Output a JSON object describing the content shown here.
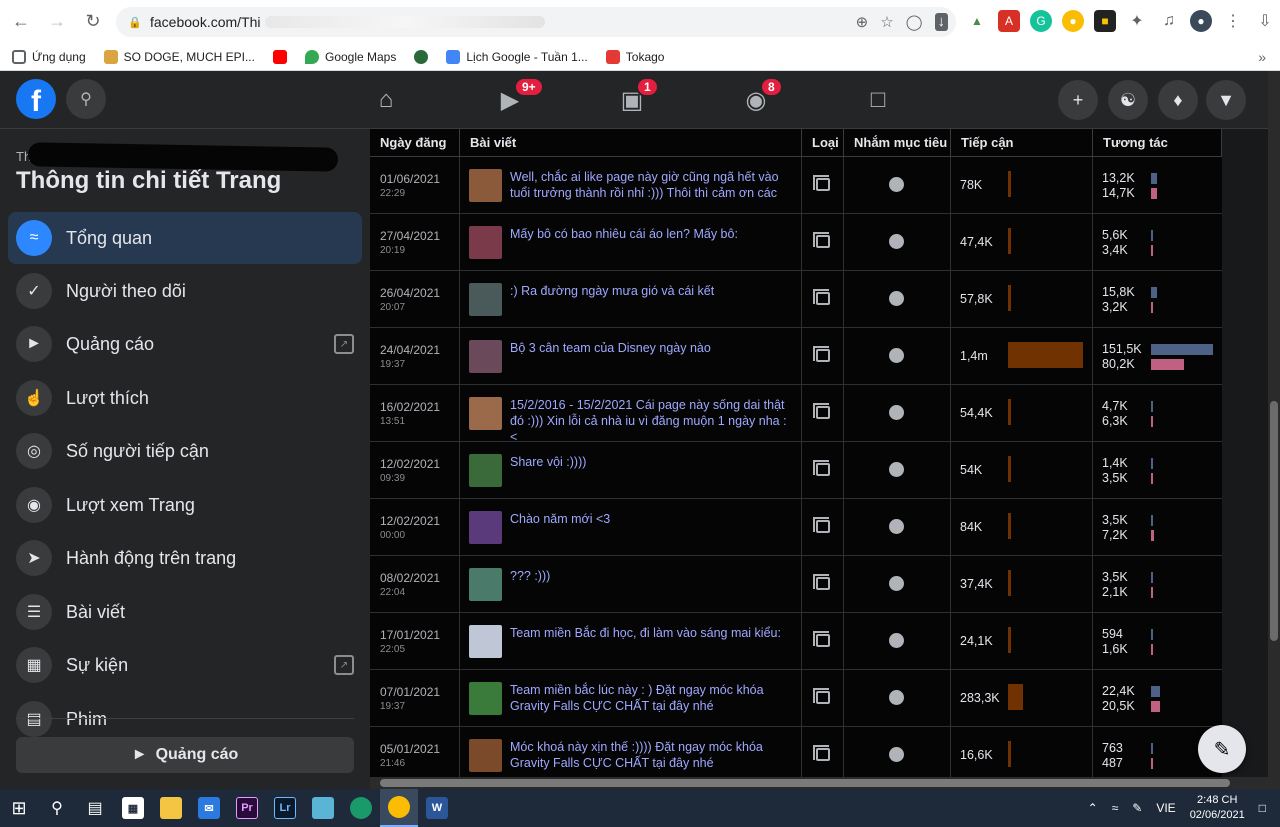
{
  "browser": {
    "url": "facebook.com/Thi",
    "bookmarks": [
      "Ứng dụng",
      "SO DOGE, MUCH EPI...",
      "Google Maps",
      "Lịch Google - Tuần 1...",
      "Tokago"
    ]
  },
  "fb_nav": {
    "badges": {
      "watch": "9+",
      "marketplace": "1",
      "groups": "8"
    }
  },
  "sidebar": {
    "page_name": "Thị",
    "title": "Thông tin chi tiết Trang",
    "items": [
      {
        "label": "Tổng quan",
        "icon": "trend-icon",
        "active": true
      },
      {
        "label": "Người theo dõi",
        "icon": "check-box-icon"
      },
      {
        "label": "Quảng cáo",
        "icon": "megaphone-icon",
        "external": true
      },
      {
        "label": "Lượt thích",
        "icon": "thumbs-up-icon"
      },
      {
        "label": "Số người tiếp cận",
        "icon": "broadcast-icon"
      },
      {
        "label": "Lượt xem Trang",
        "icon": "eye-icon"
      },
      {
        "label": "Hành động trên trang",
        "icon": "cursor-icon"
      },
      {
        "label": "Bài viết",
        "icon": "post-icon"
      },
      {
        "label": "Sự kiện",
        "icon": "calendar-icon",
        "external": true
      },
      {
        "label": "Phim",
        "icon": "film-icon"
      }
    ],
    "ad_button": "Quảng cáo"
  },
  "table": {
    "headers": [
      "Ngày đăng",
      "Bài viết",
      "Loại",
      "Nhắm mục tiêu",
      "Tiếp cận",
      "Tương tác"
    ],
    "rows": [
      {
        "date": "01/06/2021",
        "time": "22:29",
        "post": "Well, chắc ai like page này giờ cũng ngã hết vào tuổi trưởng thành rồi nhỉ :))) Thôi thì cảm ơn các",
        "reach": "78K",
        "reach_pct": 0.03,
        "e1": "13,2K",
        "e2": "14,7K",
        "e1_pct": 0.09,
        "e2_pct": 0.1,
        "thumb": "#8a5a3a"
      },
      {
        "date": "27/04/2021",
        "time": "20:19",
        "post": "Mấy bô có bao nhiêu cái áo len? Mấy bô:",
        "reach": "47,4K",
        "reach_pct": 0.02,
        "e1": "5,6K",
        "e2": "3,4K",
        "e1_pct": 0.04,
        "e2_pct": 0.03,
        "thumb": "#7a3a4a"
      },
      {
        "date": "26/04/2021",
        "time": "20:07",
        "post": ":) Ra đường ngày mưa gió và cái kết",
        "reach": "57,8K",
        "reach_pct": 0.03,
        "e1": "15,8K",
        "e2": "3,2K",
        "e1_pct": 0.1,
        "e2_pct": 0.03,
        "thumb": "#4a5a5a"
      },
      {
        "date": "24/04/2021",
        "time": "19:37",
        "post": "Bộ 3 cân team của Disney ngày nào",
        "reach": "1,4m",
        "reach_pct": 1.0,
        "e1": "151,5K",
        "e2": "80,2K",
        "e1_pct": 1.0,
        "e2_pct": 0.53,
        "thumb": "#6a4a5a"
      },
      {
        "date": "16/02/2021",
        "time": "13:51",
        "post": "15/2/2016 - 15/2/2021 Cái page này sống dai thật đó :))) Xin lỗi cả nhà iu vì đăng muộn 1 ngày nha :<",
        "reach": "54,4K",
        "reach_pct": 0.03,
        "e1": "4,7K",
        "e2": "6,3K",
        "e1_pct": 0.03,
        "e2_pct": 0.04,
        "thumb": "#9a6a4a"
      },
      {
        "date": "12/02/2021",
        "time": "09:39",
        "post": "Share vội :))))",
        "reach": "54K",
        "reach_pct": 0.03,
        "e1": "1,4K",
        "e2": "3,5K",
        "e1_pct": 0.02,
        "e2_pct": 0.03,
        "thumb": "#3a6a3a"
      },
      {
        "date": "12/02/2021",
        "time": "00:00",
        "post": "Chào năm mới <3",
        "reach": "84K",
        "reach_pct": 0.04,
        "e1": "3,5K",
        "e2": "7,2K",
        "e1_pct": 0.03,
        "e2_pct": 0.05,
        "thumb": "#5a3a7a"
      },
      {
        "date": "08/02/2021",
        "time": "22:04",
        "post": "??? :)))",
        "reach": "37,4K",
        "reach_pct": 0.02,
        "e1": "3,5K",
        "e2": "2,1K",
        "e1_pct": 0.03,
        "e2_pct": 0.02,
        "thumb": "#4a7a6a"
      },
      {
        "date": "17/01/2021",
        "time": "22:05",
        "post": "Team miền Bắc đi học, đi làm vào sáng mai kiểu:",
        "reach": "24,1K",
        "reach_pct": 0.02,
        "e1": "594",
        "e2": "1,6K",
        "e1_pct": 0.01,
        "e2_pct": 0.02,
        "thumb": "#bfc6d6"
      },
      {
        "date": "07/01/2021",
        "time": "19:37",
        "post": "Team miền bắc lúc này : ) Đặt ngay móc khóa Gravity Falls CỰC CHẤT tại đây nhé",
        "reach": "283,3K",
        "reach_pct": 0.2,
        "e1": "22,4K",
        "e2": "20,5K",
        "e1_pct": 0.15,
        "e2_pct": 0.14,
        "thumb": "#3a7a3a"
      },
      {
        "date": "05/01/2021",
        "time": "21:46",
        "post": "Móc khoá này xịn thế :)))) Đặt ngay móc khóa Gravity Falls CỰC CHẤT tại đây nhé",
        "reach": "16,6K",
        "reach_pct": 0.01,
        "e1": "763",
        "e2": "487",
        "e1_pct": 0.01,
        "e2_pct": 0.01,
        "thumb": "#7a4a2a"
      }
    ]
  },
  "taskbar": {
    "lang": "VIE",
    "time": "2:48 CH",
    "date": "02/06/2021"
  }
}
